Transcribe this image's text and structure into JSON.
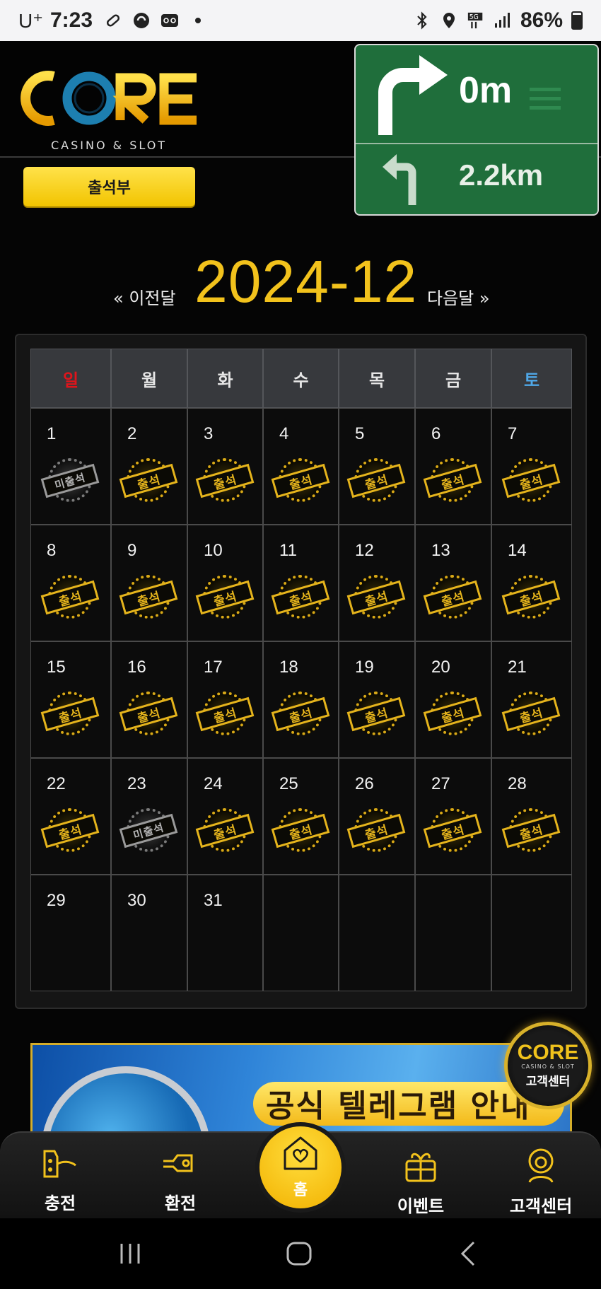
{
  "status_bar": {
    "carrier": "U⁺",
    "time": "7:23",
    "battery": "86%"
  },
  "header": {
    "logo_text": "CORE",
    "logo_sub": "CASINO & SLOT"
  },
  "navigation_overlay": {
    "distance_1": "0m",
    "distance_2": "2.2km"
  },
  "attendance_button": {
    "label": "출석부"
  },
  "month_nav": {
    "prev_label": "« 이전달",
    "month": "2024-12",
    "next_label": "다음달 »"
  },
  "calendar": {
    "weekdays": [
      {
        "label": "일",
        "color": "#e0141b"
      },
      {
        "label": "월",
        "color": "#e6e6e6"
      },
      {
        "label": "화",
        "color": "#e6e6e6"
      },
      {
        "label": "수",
        "color": "#e6e6e6"
      },
      {
        "label": "목",
        "color": "#e6e6e6"
      },
      {
        "label": "금",
        "color": "#e6e6e6"
      },
      {
        "label": "토",
        "color": "#4fa8e8"
      }
    ],
    "stamp_attended": "출석",
    "stamp_missed": "미출석",
    "weeks": [
      [
        {
          "d": "1",
          "s": "miss"
        },
        {
          "d": "2",
          "s": "att"
        },
        {
          "d": "3",
          "s": "att"
        },
        {
          "d": "4",
          "s": "att"
        },
        {
          "d": "5",
          "s": "att"
        },
        {
          "d": "6",
          "s": "att"
        },
        {
          "d": "7",
          "s": "att"
        }
      ],
      [
        {
          "d": "8",
          "s": "att"
        },
        {
          "d": "9",
          "s": "att"
        },
        {
          "d": "10",
          "s": "att"
        },
        {
          "d": "11",
          "s": "att"
        },
        {
          "d": "12",
          "s": "att"
        },
        {
          "d": "13",
          "s": "att"
        },
        {
          "d": "14",
          "s": "att"
        }
      ],
      [
        {
          "d": "15",
          "s": "att"
        },
        {
          "d": "16",
          "s": "att"
        },
        {
          "d": "17",
          "s": "att"
        },
        {
          "d": "18",
          "s": "att"
        },
        {
          "d": "19",
          "s": "att"
        },
        {
          "d": "20",
          "s": "att"
        },
        {
          "d": "21",
          "s": "att"
        }
      ],
      [
        {
          "d": "22",
          "s": "att"
        },
        {
          "d": "23",
          "s": "miss"
        },
        {
          "d": "24",
          "s": "att"
        },
        {
          "d": "25",
          "s": "att"
        },
        {
          "d": "26",
          "s": "att"
        },
        {
          "d": "27",
          "s": "att"
        },
        {
          "d": "28",
          "s": "att"
        }
      ],
      [
        {
          "d": "29",
          "s": ""
        },
        {
          "d": "30",
          "s": ""
        },
        {
          "d": "31",
          "s": ""
        },
        {
          "d": "",
          "s": ""
        },
        {
          "d": "",
          "s": ""
        },
        {
          "d": "",
          "s": ""
        },
        {
          "d": "",
          "s": ""
        }
      ]
    ]
  },
  "banner": {
    "title": "공식 텔레그램 안내"
  },
  "cs_badge": {
    "logo": "CORE",
    "sub": "CASINO & SLOT",
    "label": "고객센터"
  },
  "bottom_nav": {
    "charge": "충전",
    "exchange": "환전",
    "home": "홈",
    "event": "이벤트",
    "support": "고객센터"
  },
  "colors": {
    "accent": "#f2c21c",
    "bg": "#050505"
  }
}
